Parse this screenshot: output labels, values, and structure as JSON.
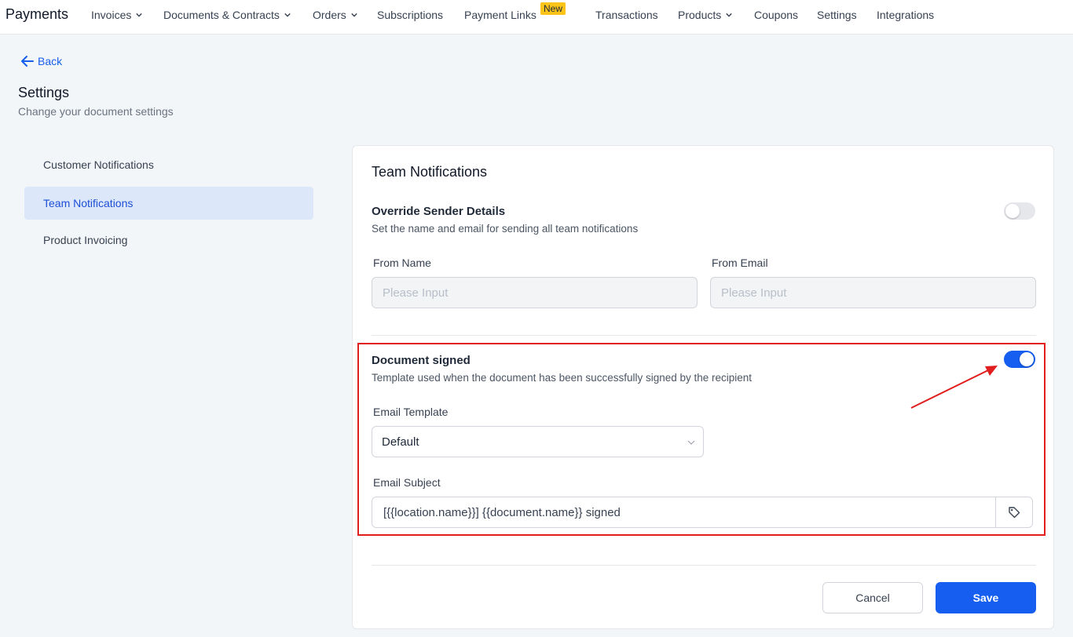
{
  "nav": {
    "brand": "Payments",
    "items": [
      {
        "label": "Invoices",
        "dropdown": true
      },
      {
        "label": "Documents & Contracts",
        "dropdown": true
      },
      {
        "label": "Orders",
        "dropdown": true
      },
      {
        "label": "Subscriptions",
        "dropdown": false
      },
      {
        "label": "Payment Links",
        "dropdown": false
      },
      {
        "label": "Transactions",
        "dropdown": false
      },
      {
        "label": "Products",
        "dropdown": true
      },
      {
        "label": "Coupons",
        "dropdown": false
      },
      {
        "label": "Settings",
        "dropdown": false
      },
      {
        "label": "Integrations",
        "dropdown": false
      }
    ],
    "new_badge": "New"
  },
  "header": {
    "back_label": "Back",
    "title": "Settings",
    "subtitle": "Change your document settings"
  },
  "sidebar": {
    "items": [
      {
        "label": "Customer Notifications",
        "active": false
      },
      {
        "label": "Team Notifications",
        "active": true
      },
      {
        "label": "Product Invoicing",
        "active": false
      }
    ]
  },
  "card": {
    "title": "Team Notifications",
    "override": {
      "title": "Override Sender Details",
      "description": "Set the name and email for sending all team notifications",
      "enabled": false,
      "from_name_label": "From Name",
      "from_name_placeholder": "Please Input",
      "from_email_label": "From Email",
      "from_email_placeholder": "Please Input"
    },
    "document_signed": {
      "title": "Document signed",
      "description": "Template used when the document has been successfully signed by the recipient",
      "enabled": true,
      "email_template_label": "Email Template",
      "email_template_value": "Default",
      "email_subject_label": "Email Subject",
      "email_subject_value": "[{{location.name}}] {{document.name}} signed"
    },
    "cancel_label": "Cancel",
    "save_label": "Save"
  },
  "colors": {
    "accent": "#155eef",
    "highlight": "#e11d1d",
    "badge": "#fcc419"
  },
  "icons": {
    "back": "arrow-left-icon",
    "dropdown": "chevron-down-icon",
    "tag": "tag-icon"
  }
}
